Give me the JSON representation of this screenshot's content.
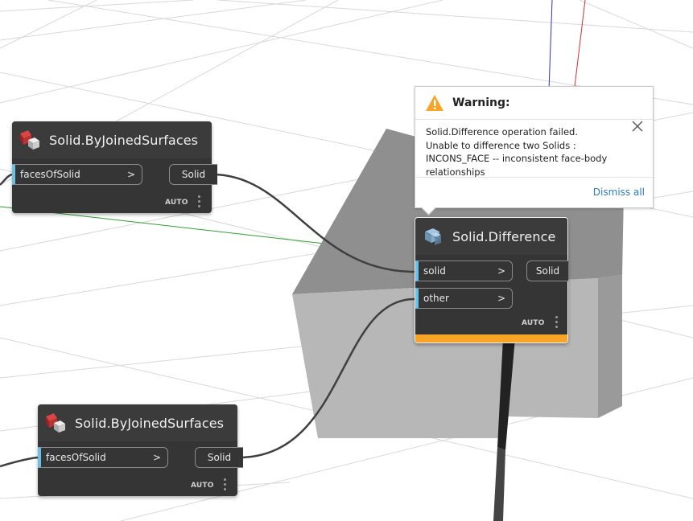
{
  "nodes": {
    "joined_top": {
      "title": "Solid.ByJoinedSurfaces",
      "input": {
        "label": "facesOfSolid",
        "arrow": ">"
      },
      "output": {
        "label": "Solid"
      },
      "lacing": "AUTO"
    },
    "joined_bottom": {
      "title": "Solid.ByJoinedSurfaces",
      "input": {
        "label": "facesOfSolid",
        "arrow": ">"
      },
      "output": {
        "label": "Solid"
      },
      "lacing": "AUTO"
    },
    "difference": {
      "title": "Solid.Difference",
      "inputs": [
        {
          "label": "solid",
          "arrow": ">"
        },
        {
          "label": "other",
          "arrow": ">"
        }
      ],
      "output": {
        "label": "Solid"
      },
      "lacing": "AUTO",
      "status_color": "#f8a427"
    }
  },
  "warning": {
    "title": "Warning:",
    "message": "Solid.Difference operation failed.\nUnable to difference two Solids :\nINCONS_FACE -- inconsistent face-body\nrelationships",
    "dismiss_label": "Dismiss all",
    "icon": "warning-triangle-icon",
    "close_icon": "close-icon"
  },
  "colors": {
    "node_body": "#353535",
    "input_port_accent": "#6ac0e7",
    "warning_status": "#f8a427",
    "link": "#2b7bbd",
    "axis_x": "#d03030",
    "axis_y": "#3030d0",
    "axis_z": "#30a030"
  }
}
